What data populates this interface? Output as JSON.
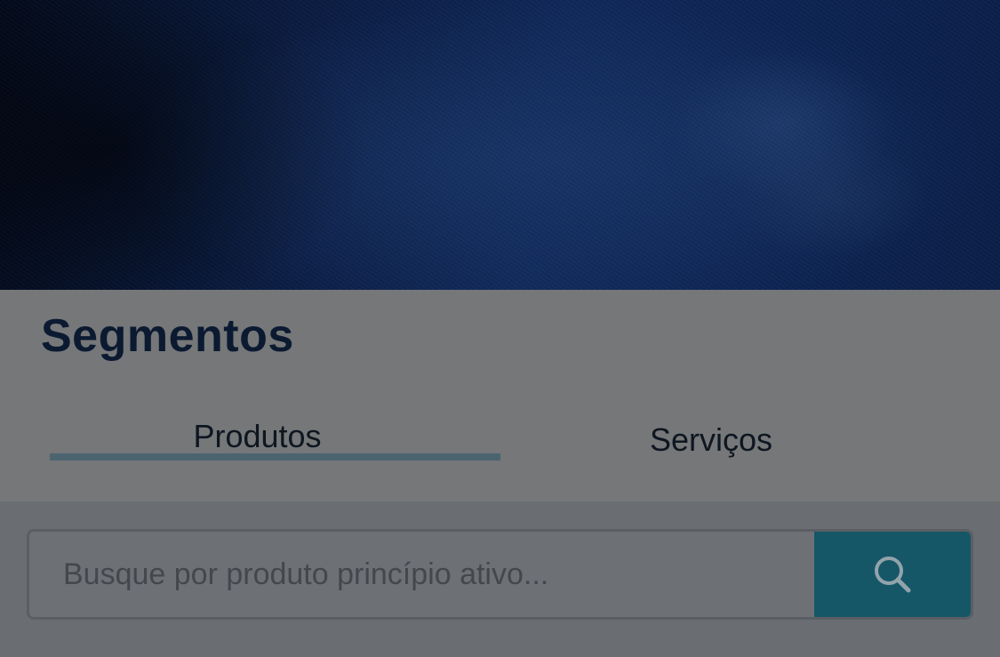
{
  "segments": {
    "title": "Segmentos",
    "tabs": [
      {
        "label": "Produtos",
        "active": true
      },
      {
        "label": "Serviços",
        "active": false
      }
    ]
  },
  "search": {
    "placeholder": "Busque por produto princípio ativo...",
    "value": "",
    "button_icon": "search-icon"
  },
  "colors": {
    "hero_navy": "#10285a",
    "title_text": "#0b1a30",
    "tab_underline": "#4c6470",
    "search_button": "#155767"
  }
}
